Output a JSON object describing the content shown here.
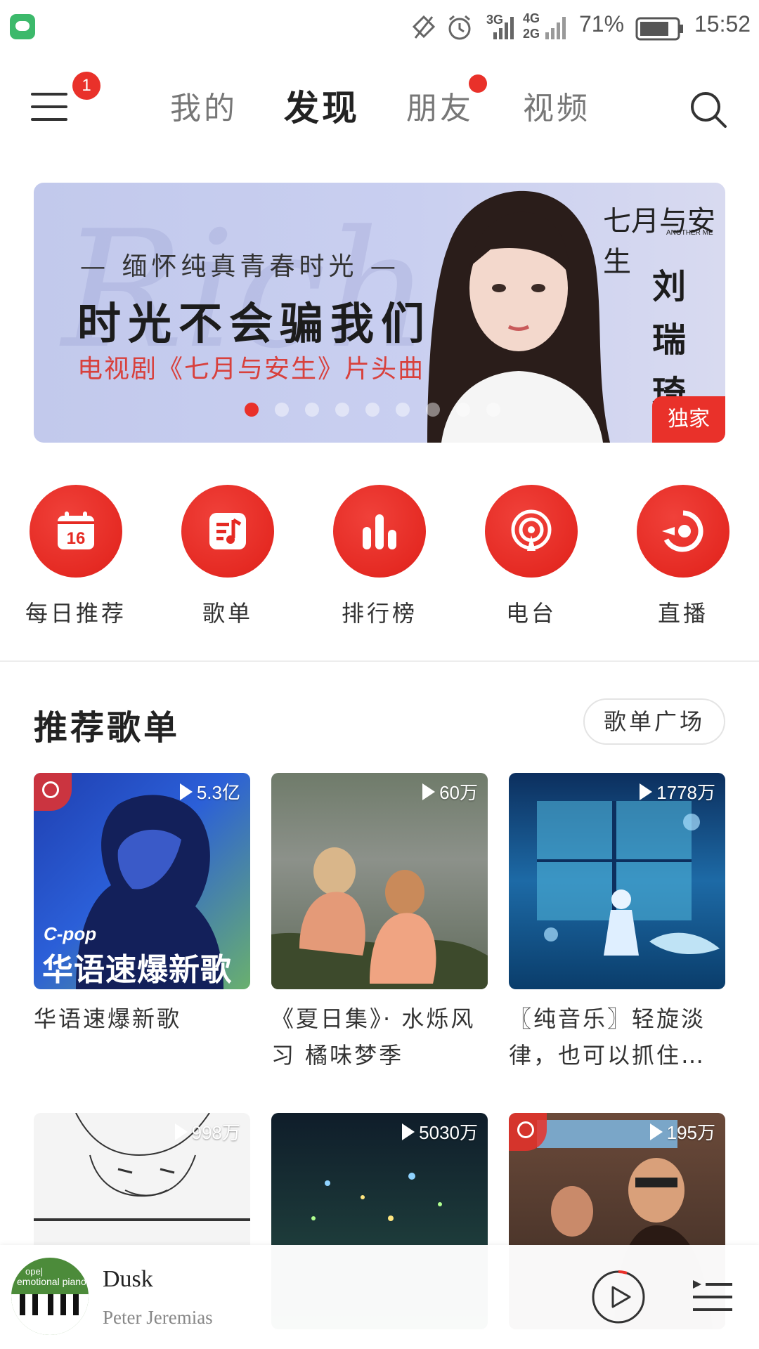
{
  "status_bar": {
    "battery": "71%",
    "time": "15:52",
    "net1": "3G",
    "net2": "4G",
    "net3": "2G"
  },
  "header": {
    "menu_badge": "1",
    "tabs": [
      {
        "label": "我的",
        "active": false
      },
      {
        "label": "发现",
        "active": true
      },
      {
        "label": "朋友",
        "active": false,
        "dot": true
      },
      {
        "label": "视频",
        "active": false
      }
    ]
  },
  "banner": {
    "script_watermark": "Richal",
    "subtitle": "— 缅怀纯真青春时光 —",
    "title": "时光不会骗我们",
    "description": "电视剧《七月与安生》片头曲",
    "logo": "七月与安生",
    "logo_en": "ANOTHER ME",
    "artist_chars": [
      "刘",
      "瑞",
      "琦"
    ],
    "badge": "独家",
    "dot_count": 9,
    "active_dot": 0
  },
  "quick_icons": [
    {
      "label": "每日推荐",
      "icon": "calendar-icon",
      "day": "16"
    },
    {
      "label": "歌单",
      "icon": "playlist-icon"
    },
    {
      "label": "排行榜",
      "icon": "chart-bars-icon"
    },
    {
      "label": "电台",
      "icon": "radio-icon"
    },
    {
      "label": "直播",
      "icon": "live-icon"
    }
  ],
  "section": {
    "title": "推荐歌单",
    "button": "歌单广场"
  },
  "playlists": [
    {
      "title": "华语速爆新歌",
      "plays": "5.3亿",
      "cover_line1": "C-pop",
      "cover_line2": "华语速爆新歌"
    },
    {
      "title": "《夏日集》· 水烁风习 橘味梦季",
      "plays": "60万"
    },
    {
      "title": "〖纯音乐〗轻旋淡律，也可以抓住…",
      "plays": "1778万"
    },
    {
      "title": "",
      "plays": "998万"
    },
    {
      "title": "",
      "plays": "5030万"
    },
    {
      "title": "",
      "plays": "195万"
    }
  ],
  "player": {
    "title": "Dusk",
    "artist": "Peter Jeremias",
    "art_line1": "ope|",
    "art_line2": "emotional piano"
  },
  "colors": {
    "accent": "#e9312a",
    "banner_bg": "#c2c9ec"
  }
}
